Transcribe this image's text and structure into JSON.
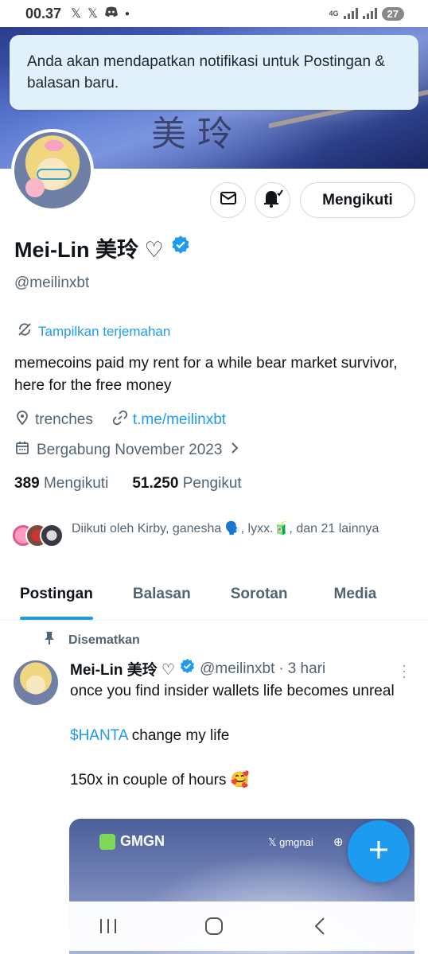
{
  "status_bar": {
    "time": "00.37",
    "network": "4G",
    "battery": "27"
  },
  "toast": {
    "text": "Anda akan mendapatkan notifikasi untuk Postingan & balasan baru."
  },
  "profile": {
    "name": "Mei-Lin 美玲 ♡",
    "handle": "@meilinxbt",
    "translate_label": "Tampilkan terjemahan",
    "bio": "memecoins paid my rent for a while  bear market survivor, here for the free money",
    "location": "trenches",
    "link": "t.me/meilinxbt",
    "joined": "Bergabung November 2023",
    "following_count": "389",
    "following_label": "Mengikuti",
    "followers_count": "51.250",
    "followers_label": "Pengikut",
    "followed_by": "Diikuti oleh Kirby, ganesha 🗣️, lyxx.🧃, dan 21 lainnya",
    "follow_button": "Mengikuti"
  },
  "tabs": [
    "Postingan",
    "Balasan",
    "Sorotan",
    "Media"
  ],
  "pinned_tweet": {
    "pinned_label": "Disematkan",
    "name": "Mei-Lin 美玲 ♡",
    "handle": "@meilinxbt",
    "time": "3 hari",
    "text_1": "once you find insider wallets life becomes unreal",
    "cashtag": "$HANTA",
    "text_2": " change my life",
    "text_3": "150x in couple of hours 🥰",
    "media_brand": "GMGN",
    "media_x_handle": "gmgnai"
  },
  "colors": {
    "accent": "#1d9bf0",
    "text": "#0f1419",
    "muted": "#536471",
    "toast_bg": "#e1f1fb"
  },
  "icons": {
    "message": "envelope-icon",
    "notify": "bell-check-icon",
    "translate": "translate-icon",
    "location": "location-pin-icon",
    "link": "link-icon",
    "calendar": "calendar-icon",
    "verified": "verified-badge-icon",
    "pin": "pin-icon",
    "compose": "plus-icon"
  }
}
